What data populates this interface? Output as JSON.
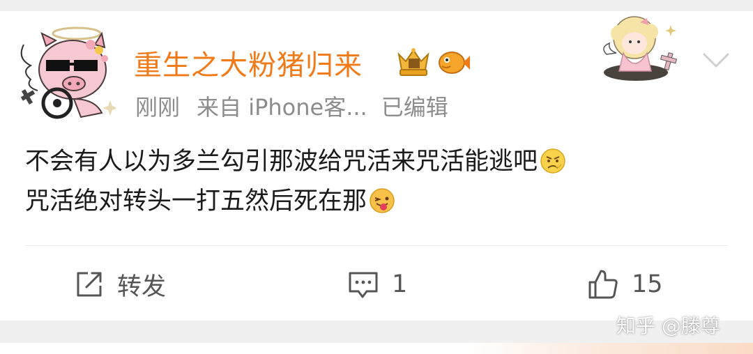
{
  "post": {
    "username": "重生之大粉猪归来",
    "meta": {
      "time": "刚刚",
      "source": "来自 iPhone客...",
      "edited": "已编辑"
    },
    "content": {
      "line1": "不会有人以为多兰勾引那波给咒活来咒活能逃吧",
      "line2": "咒活绝对转头一打五然后死在那"
    },
    "actions": {
      "repost_label": "转发",
      "comment_count": "1",
      "like_count": "15"
    }
  },
  "watermark": "知乎 @滕尊",
  "colors": {
    "username": "#f07a18",
    "meta": "#8c8c8c",
    "text": "#1a1a1a",
    "action": "#555555"
  },
  "icons": [
    "avatar-pig-image",
    "vip-crown-badge",
    "fish-badge",
    "angel-card-decoration",
    "chevron-down-icon",
    "frown-emoji",
    "tongue-emoji",
    "repost-icon",
    "comment-icon",
    "like-icon"
  ]
}
